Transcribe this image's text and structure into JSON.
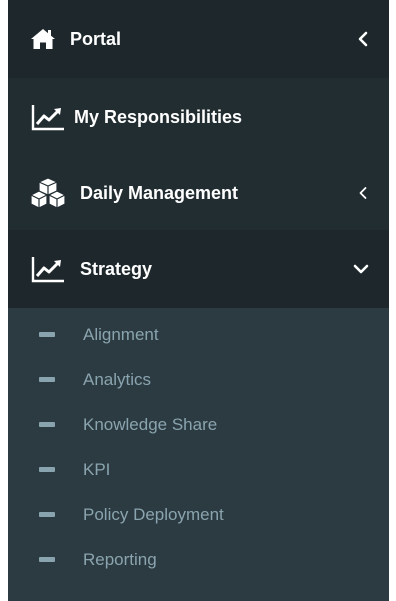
{
  "menu": {
    "portal": {
      "label": "Portal",
      "icon": "home-icon",
      "chevron": "chevron-left-icon"
    },
    "responsibilities": {
      "label": "My Responsibilities",
      "icon": "line-chart-icon"
    },
    "daily": {
      "label": "Daily Management",
      "icon": "cubes-icon",
      "chevron": "chevron-left-icon"
    },
    "strategy": {
      "label": "Strategy",
      "icon": "line-chart-icon",
      "chevron": "chevron-down-icon",
      "items": [
        {
          "label": "Alignment"
        },
        {
          "label": "Analytics"
        },
        {
          "label": "Knowledge Share"
        },
        {
          "label": "KPI"
        },
        {
          "label": "Policy Deployment"
        },
        {
          "label": "Reporting"
        }
      ]
    }
  },
  "colors": {
    "sidebar_bg": "#222d32",
    "active_bg": "#1e282c",
    "submenu_bg": "#2c3b41",
    "submenu_text": "#8aa4af",
    "text": "#ffffff"
  }
}
